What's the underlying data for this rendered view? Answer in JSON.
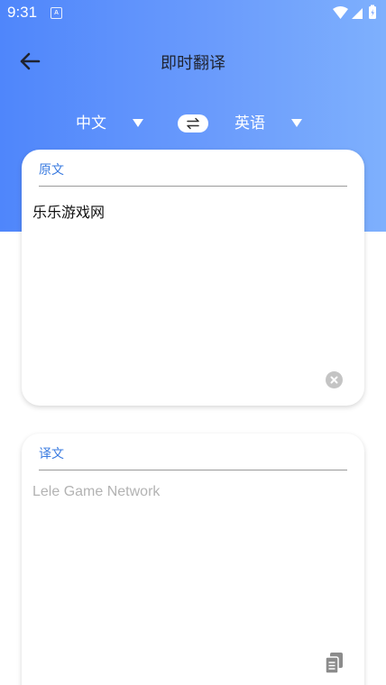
{
  "status_bar": {
    "time": "9:31",
    "app_icon_letter": "A"
  },
  "header": {
    "title": "即时翻译"
  },
  "languages": {
    "source": "中文",
    "target": "英语"
  },
  "source_card": {
    "label": "原文",
    "text": "乐乐游戏网"
  },
  "target_card": {
    "label": "译文",
    "text": "Lele Game Network"
  },
  "colors": {
    "header_gradient_start": "#4f86fb",
    "header_gradient_end": "#7eb0fd",
    "accent_label": "#3a7be0"
  },
  "icons": {
    "back": "arrow-left-icon",
    "swap": "swap-arrows-icon",
    "clear": "clear-circle-icon",
    "copy": "copy-icon"
  }
}
